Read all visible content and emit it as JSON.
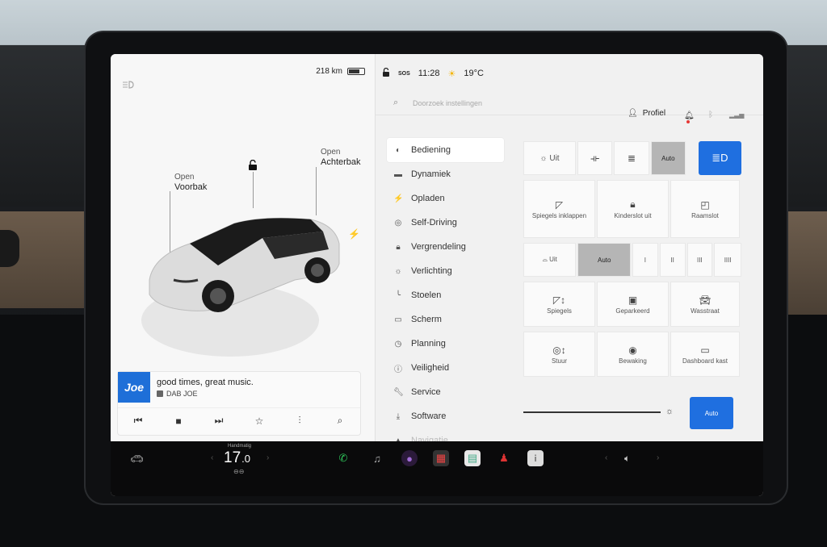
{
  "status": {
    "range": "218 km",
    "time": "11:28",
    "temperature": "19°C",
    "sos": "SOS"
  },
  "car_view": {
    "frunk_state": "Open",
    "frunk_label": "Voorbak",
    "trunk_state": "Open",
    "trunk_label": "Achterbak"
  },
  "media": {
    "station_logo": "Joe",
    "title": "good times, great music.",
    "source": "DAB JOE"
  },
  "search": {
    "placeholder": "Doorzoek instellingen"
  },
  "profile": {
    "label": "Profiel"
  },
  "menu": {
    "items": [
      {
        "label": "Bediening"
      },
      {
        "label": "Dynamiek"
      },
      {
        "label": "Opladen"
      },
      {
        "label": "Self-Driving"
      },
      {
        "label": "Vergrendeling"
      },
      {
        "label": "Verlichting"
      },
      {
        "label": "Stoelen"
      },
      {
        "label": "Scherm"
      },
      {
        "label": "Planning"
      },
      {
        "label": "Veiligheid"
      },
      {
        "label": "Service"
      },
      {
        "label": "Software"
      },
      {
        "label": "Navigatie"
      }
    ]
  },
  "controls": {
    "lights": {
      "off": "Uit",
      "auto": "Auto"
    },
    "tiles_row1": {
      "mirrors_fold": "Spiegels inklappen",
      "child_lock": "Kinderslot uit",
      "window_lock": "Raamslot"
    },
    "wipers": {
      "off": "Uit",
      "auto": "Auto",
      "level1": "I",
      "level2": "II",
      "level3": "III",
      "level4": "IIII"
    },
    "tiles_row2": {
      "mirrors": "Spiegels",
      "parked": "Geparkeerd",
      "car_wash": "Wasstraat"
    },
    "tiles_row3": {
      "steering": "Stuur",
      "sentry": "Bewaking",
      "glovebox": "Dashboard kast"
    },
    "brightness_auto": "Auto"
  },
  "dock": {
    "climate_mode": "Handmatig",
    "temp_int": "17",
    "temp_dec": ".0"
  }
}
